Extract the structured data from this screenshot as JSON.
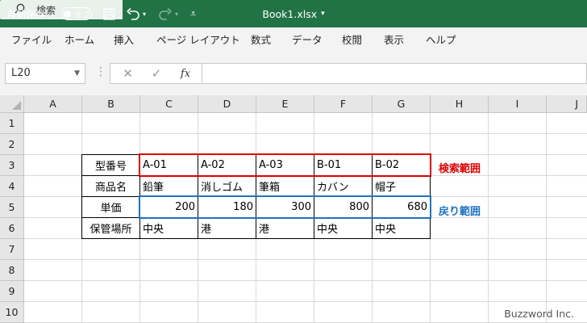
{
  "titlebar": {
    "autosave_label": "自動保存",
    "autosave_toggle": "オフ",
    "save_icon": "save-icon",
    "undo_icon": "undo-icon",
    "redo_icon": "redo-icon",
    "customize_icon": "customize-quick-access-icon",
    "doc_title": "Book1.xlsx",
    "search_placeholder": "検索",
    "bg_color": "#217346"
  },
  "menu": [
    "ファイル",
    "ホーム",
    "挿入",
    "ページ レイアウト",
    "数式",
    "データ",
    "校閲",
    "表示",
    "ヘルプ"
  ],
  "formula_bar": {
    "name_box": "L20",
    "cancel_icon": "✕",
    "enter_icon": "✓",
    "fx": "fx",
    "formula": ""
  },
  "columns": [
    "A",
    "B",
    "C",
    "D",
    "E",
    "F",
    "G",
    "H",
    "I",
    "J"
  ],
  "rows": [
    "1",
    "2",
    "3",
    "4",
    "5",
    "6",
    "7",
    "8",
    "9",
    "10"
  ],
  "sheet": {
    "B3": "型番号",
    "B4": "商品名",
    "B5": "単価",
    "B6": "保管場所",
    "C3": "A-01",
    "D3": "A-02",
    "E3": "A-03",
    "F3": "B-01",
    "G3": "B-02",
    "C4": "鉛筆",
    "D4": "消しゴム",
    "E4": "筆箱",
    "F4": "カバン",
    "G4": "帽子",
    "C5": "200",
    "D5": "180",
    "E5": "300",
    "F5": "800",
    "G5": "680",
    "C6": "中央",
    "D6": "港",
    "E6": "港",
    "F6": "中央",
    "G6": "中央"
  },
  "annotations": {
    "search_range": "検索範囲",
    "return_range": "戻り範囲",
    "search_color": "#e00000",
    "return_color": "#1e73c2"
  },
  "watermark": "Buzzword Inc."
}
